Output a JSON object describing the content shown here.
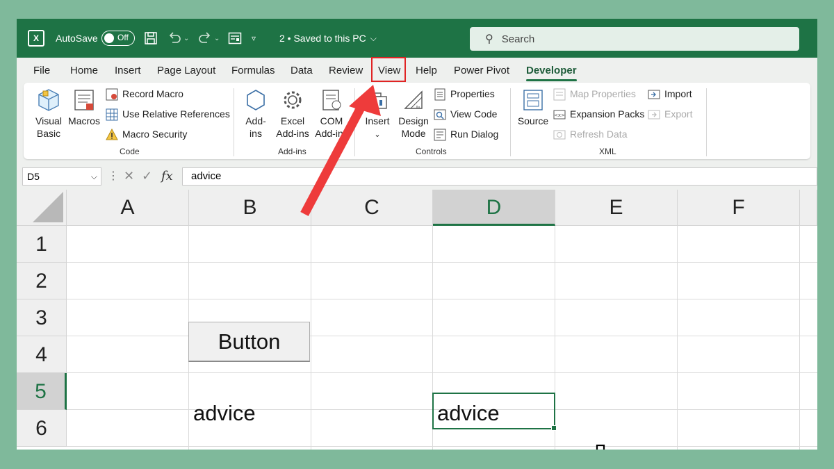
{
  "titlebar": {
    "app_icon": "excel-logo-icon",
    "autosave_label": "AutoSave",
    "autosave_state": "Off",
    "doc_title": "2 • Saved to this PC",
    "search_placeholder": "Search"
  },
  "menu": {
    "file": "File",
    "home": "Home",
    "insert": "Insert",
    "page_layout": "Page Layout",
    "formulas": "Formulas",
    "data": "Data",
    "review": "Review",
    "view": "View",
    "help": "Help",
    "power_pivot": "Power Pivot",
    "developer": "Developer"
  },
  "ribbon": {
    "code": {
      "visual_basic_1": "Visual",
      "visual_basic_2": "Basic",
      "macros": "Macros",
      "record_macro": "Record Macro",
      "use_relative": "Use Relative References",
      "macro_security": "Macro Security",
      "group": "Code"
    },
    "addins": {
      "addins_1": "Add-",
      "addins_2": "ins",
      "excel_addins_1": "Excel",
      "excel_addins_2": "Add-ins",
      "com_addins_1": "COM",
      "com_addins_2": "Add-ins",
      "group": "Add-ins"
    },
    "controls": {
      "insert": "Insert",
      "design_mode_1": "Design",
      "design_mode_2": "Mode",
      "properties": "Properties",
      "view_code": "View Code",
      "run_dialog": "Run Dialog",
      "group": "Controls"
    },
    "xml": {
      "source": "Source",
      "map_properties": "Map Properties",
      "expansion_packs": "Expansion Packs",
      "refresh_data": "Refresh Data",
      "import": "Import",
      "export": "Export",
      "group": "XML"
    }
  },
  "formula_bar": {
    "name_box": "D5",
    "fx": "fx",
    "value": "advice"
  },
  "sheet": {
    "columns": [
      "A",
      "B",
      "C",
      "D",
      "E",
      "F"
    ],
    "rows": [
      "1",
      "2",
      "3",
      "4",
      "5",
      "6"
    ],
    "selected_column": "D",
    "selected_row": "5",
    "button_label": "Button",
    "b5": "advice",
    "d5": "advice"
  },
  "colors": {
    "title_green": "#1e7345",
    "highlight_red": "#e02424",
    "background": "#7fb99b"
  }
}
